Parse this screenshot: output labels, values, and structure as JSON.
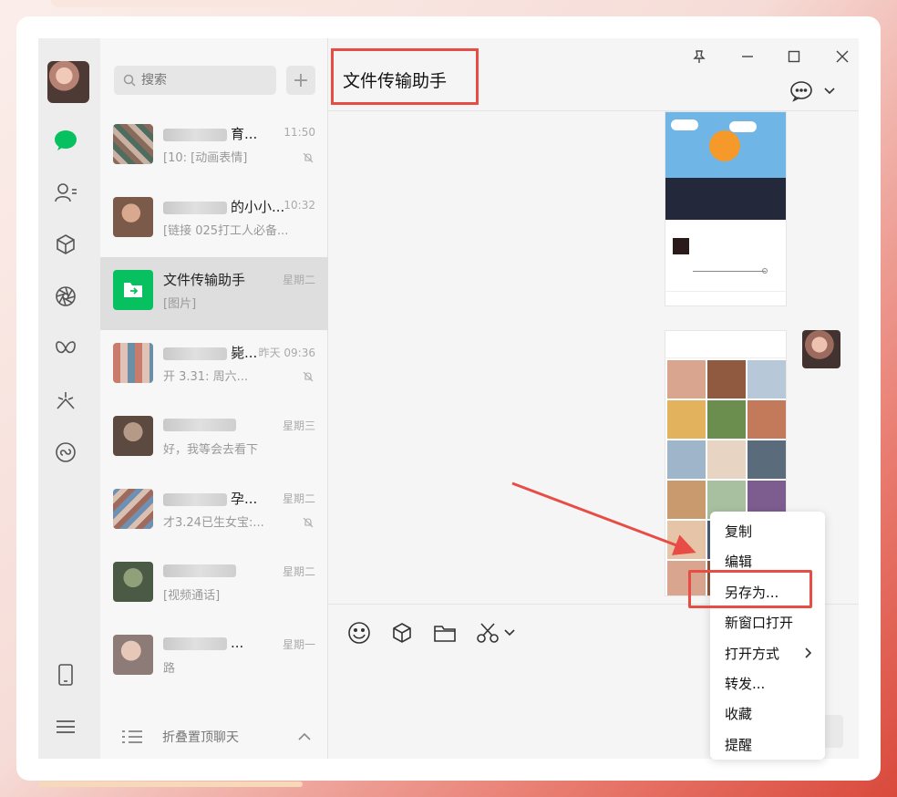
{
  "window": {
    "title": "文件传输助手"
  },
  "search": {
    "placeholder": "搜索"
  },
  "chats": [
    {
      "name": "育...",
      "msg": "[10: [动画表情]",
      "time": "11:50",
      "muted": true
    },
    {
      "name": "的小小...",
      "msg": "[链接 025打工人必备...",
      "time": "10:32",
      "muted": false
    },
    {
      "name": "文件传输助手",
      "msg": "[图片]",
      "time": "星期二",
      "muted": false,
      "selected": true
    },
    {
      "name": "毙...",
      "msg": "开 3.31: 周六...",
      "time": "昨天 09:36",
      "muted": true
    },
    {
      "name": "",
      "msg": "好，我等会去看下",
      "time": "星期三",
      "muted": false
    },
    {
      "name": "孕...",
      "msg": "才3.24已生女宝:...",
      "time": "星期二",
      "muted": true
    },
    {
      "name": "",
      "msg": "[视频通话]",
      "time": "星期二",
      "muted": false
    },
    {
      "name": "...",
      "msg": "路",
      "time": "星期一",
      "muted": false
    }
  ],
  "fold": {
    "label": "折叠置顶聊天"
  },
  "context_menu": {
    "items": [
      "复制",
      "编辑",
      "另存为...",
      "新窗口打开",
      "打开方式",
      "转发...",
      "收藏",
      "提醒"
    ],
    "highlighted": "另存为..."
  },
  "colors": {
    "accent": "#07c160",
    "highlight": "#e74c45",
    "arrow": "#e74c45"
  }
}
